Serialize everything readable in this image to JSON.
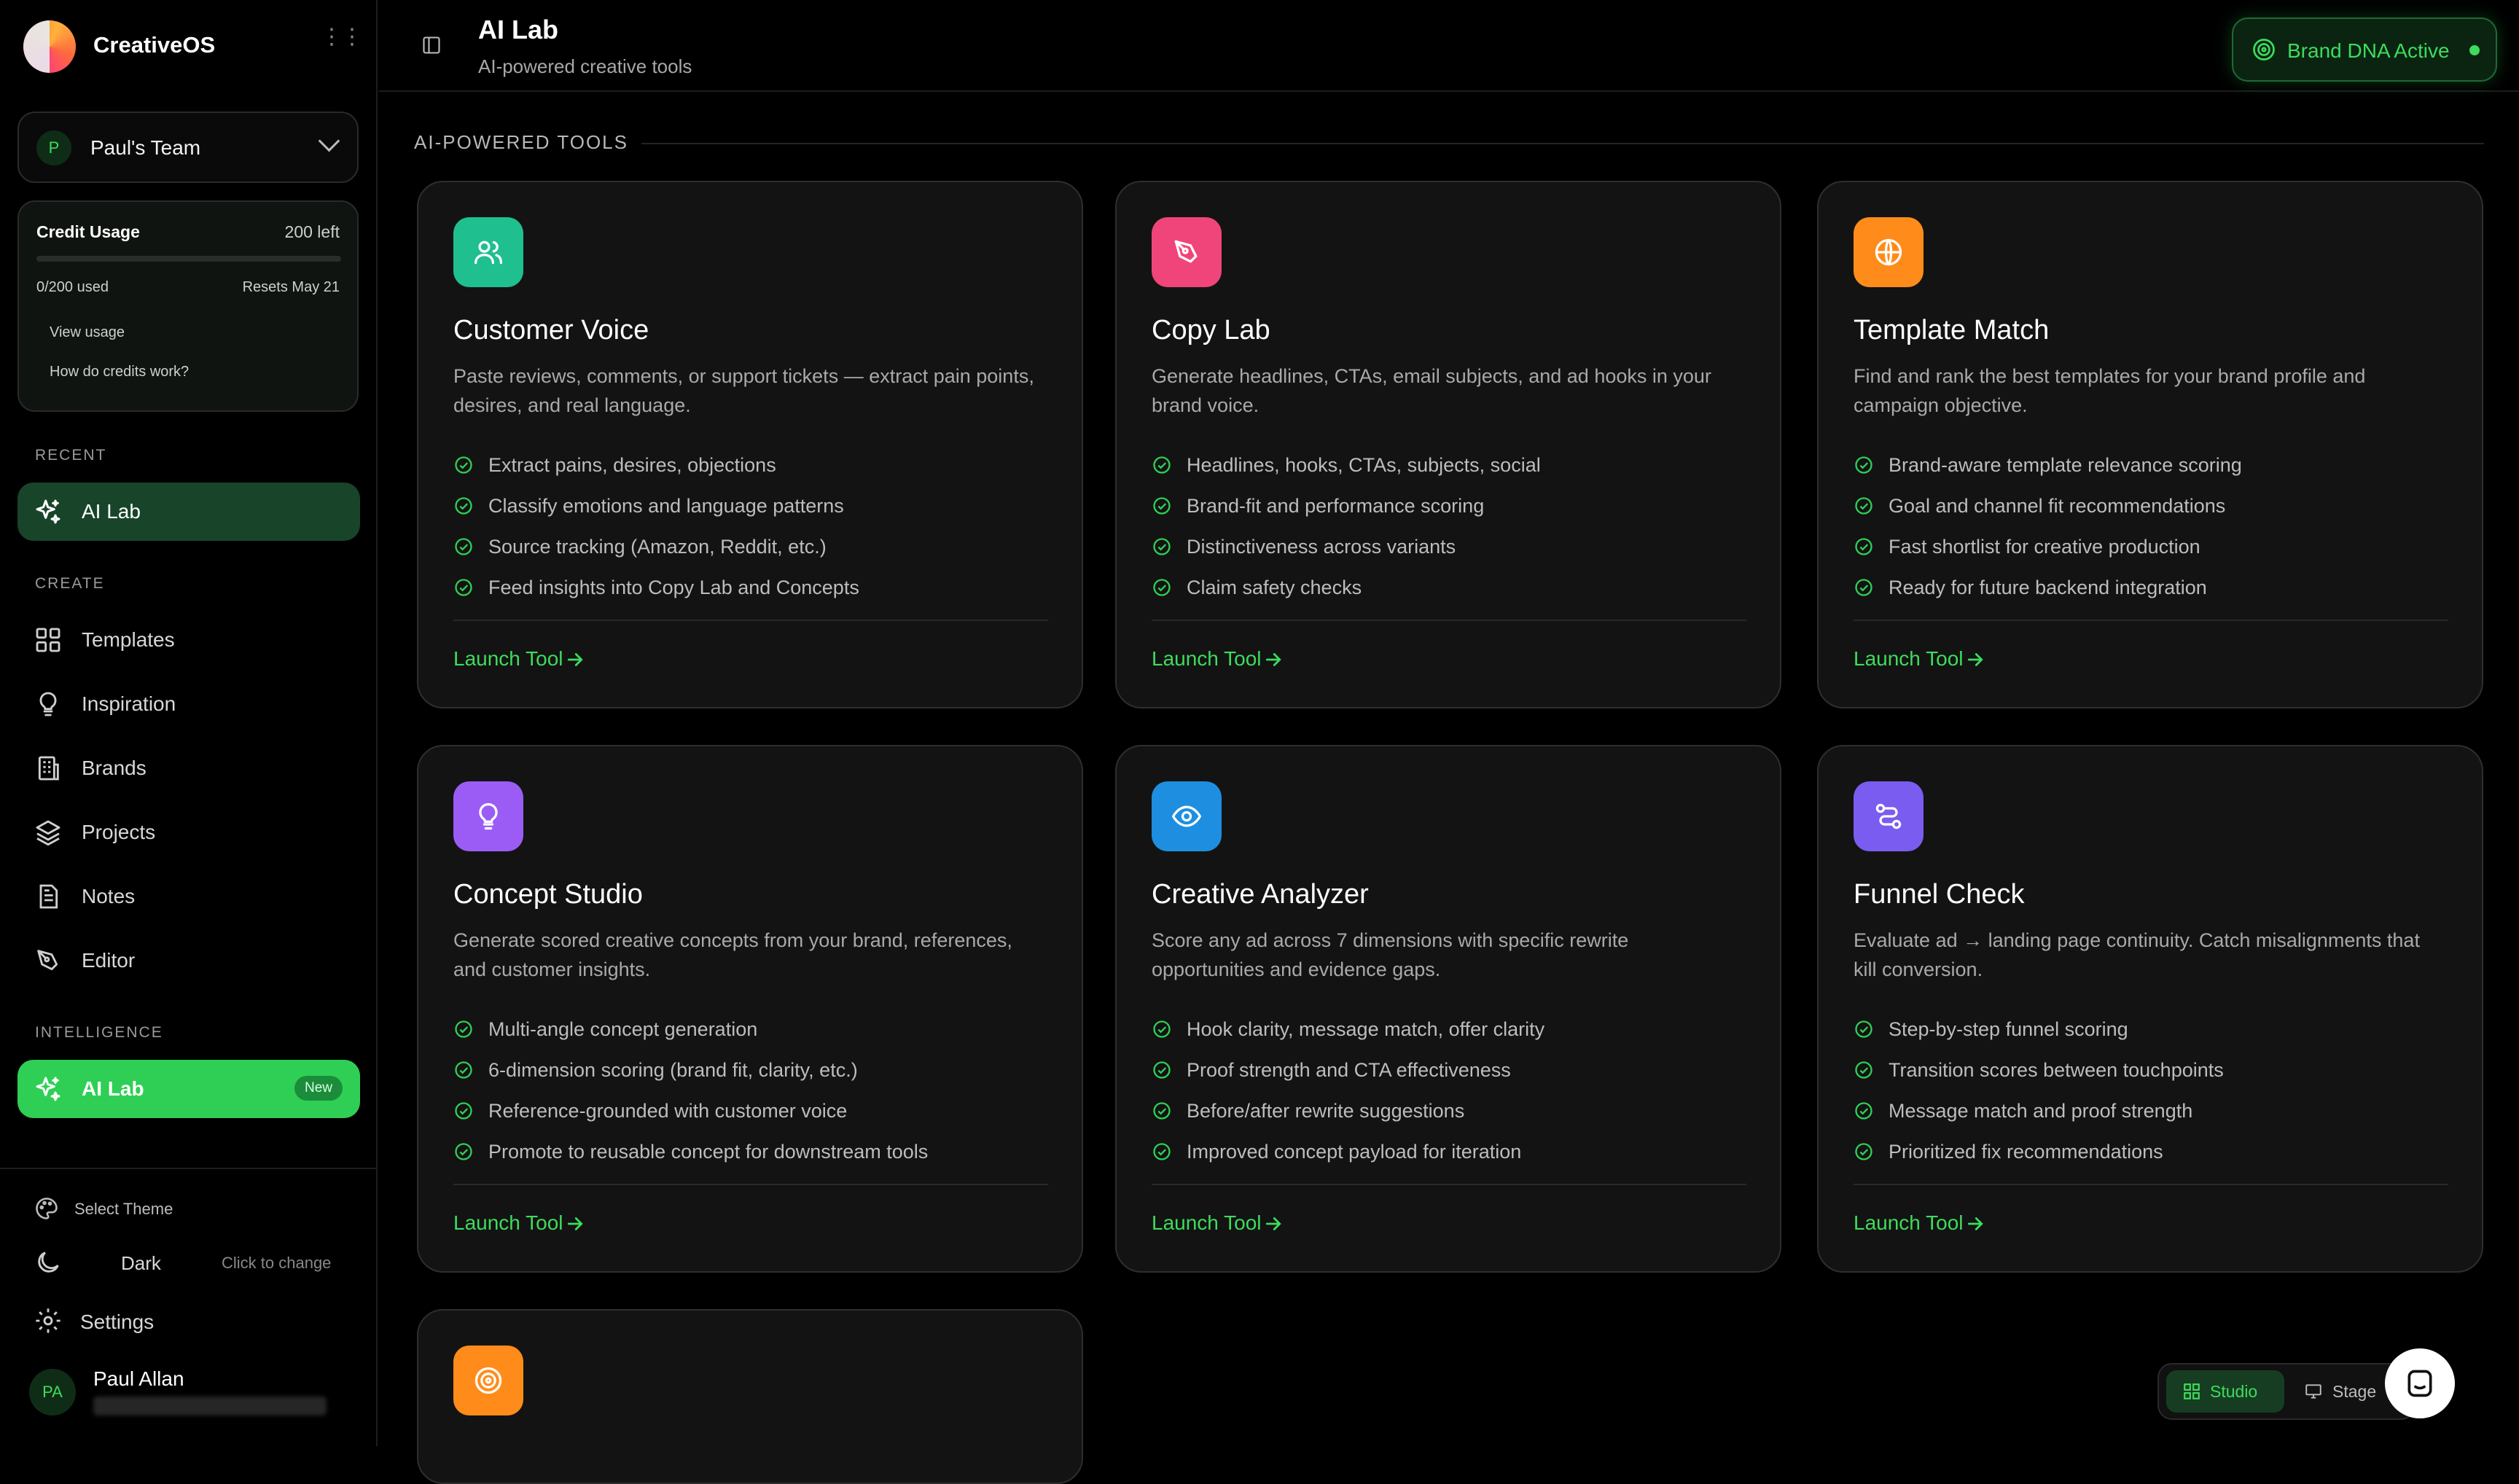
{
  "app": {
    "name": "CreativeOS"
  },
  "team": {
    "avatar": "P",
    "name": "Paul's Team"
  },
  "credits": {
    "title": "Credit Usage",
    "left": "200 left",
    "used_label": "0/200 used",
    "used_fraction": 0.0,
    "resets": "Resets May 21",
    "link_usage": "View usage",
    "link_help": "How do credits work?"
  },
  "sidebar": {
    "recent_heading": "RECENT",
    "recent_item": {
      "label": "AI Lab",
      "icon": "sparkles-icon"
    },
    "create_heading": "CREATE",
    "create_items": [
      {
        "label": "Templates",
        "icon": "grid-icon"
      },
      {
        "label": "Inspiration",
        "icon": "lightbulb-icon"
      },
      {
        "label": "Brands",
        "icon": "building-icon"
      },
      {
        "label": "Projects",
        "icon": "layers-icon"
      },
      {
        "label": "Notes",
        "icon": "document-icon"
      },
      {
        "label": "Editor",
        "icon": "pen-tool-icon"
      }
    ],
    "intelligence_heading": "INTELLIGENCE",
    "intelligence_item": {
      "label": "AI Lab",
      "badge": "New",
      "icon": "sparkles-icon"
    },
    "theme_label": "Select Theme",
    "theme_value": "Dark",
    "theme_hint": "Click to change",
    "settings_label": "Settings",
    "user": {
      "initials": "PA",
      "name": "Paul Allan"
    }
  },
  "header": {
    "title": "AI Lab",
    "subtitle": "AI-powered creative tools",
    "brand_dna": "Brand DNA Active"
  },
  "section_heading": "AI-POWERED TOOLS",
  "launch_label": "Launch Tool",
  "cards": [
    {
      "title": "Customer Voice",
      "icon": "users-icon",
      "color": "#1fbf8f",
      "desc": "Paste reviews, comments, or support tickets — extract pain points, desires, and real language.",
      "features": [
        "Extract pains, desires, objections",
        "Classify emotions and language patterns",
        "Source tracking (Amazon, Reddit, etc.)",
        "Feed insights into Copy Lab and Concepts"
      ]
    },
    {
      "title": "Copy Lab",
      "icon": "pen-nib-icon",
      "color": "#f0457a",
      "desc": "Generate headlines, CTAs, email subjects, and ad hooks in your brand voice.",
      "features": [
        "Headlines, hooks, CTAs, subjects, social",
        "Brand-fit and performance scoring",
        "Distinctiveness across variants",
        "Claim safety checks"
      ]
    },
    {
      "title": "Template Match",
      "icon": "globe-icon",
      "color": "#ff8c1a",
      "desc": "Find and rank the best templates for your brand profile and campaign objective.",
      "features": [
        "Brand-aware template relevance scoring",
        "Goal and channel fit recommendations",
        "Fast shortlist for creative production",
        "Ready for future backend integration"
      ]
    },
    {
      "title": "Concept Studio",
      "icon": "lightbulb-icon",
      "color": "#9b5cf6",
      "desc": "Generate scored creative concepts from your brand, references, and customer insights.",
      "features": [
        "Multi-angle concept generation",
        "6-dimension scoring (brand fit, clarity, etc.)",
        "Reference-grounded with customer voice",
        "Promote to reusable concept for downstream tools"
      ]
    },
    {
      "title": "Creative Analyzer",
      "icon": "eye-icon",
      "color": "#1e8fe0",
      "desc": "Score any ad across 7 dimensions with specific rewrite opportunities and evidence gaps.",
      "features": [
        "Hook clarity, message match, offer clarity",
        "Proof strength and CTA effectiveness",
        "Before/after rewrite suggestions",
        "Improved concept payload for iteration"
      ]
    },
    {
      "title": "Funnel Check",
      "icon": "route-icon",
      "color": "#7b5cf0",
      "desc": "Evaluate ad → landing page continuity. Catch misalignments that kill conversion.",
      "features": [
        "Step-by-step funnel scoring",
        "Transition scores between touchpoints",
        "Message match and proof strength",
        "Prioritized fix recommendations"
      ]
    },
    {
      "title": "",
      "icon": "target-icon",
      "color": "#ff8c1a",
      "desc": "",
      "features": []
    }
  ],
  "mode_switch": {
    "studio": "Studio",
    "stage": "Stage"
  }
}
